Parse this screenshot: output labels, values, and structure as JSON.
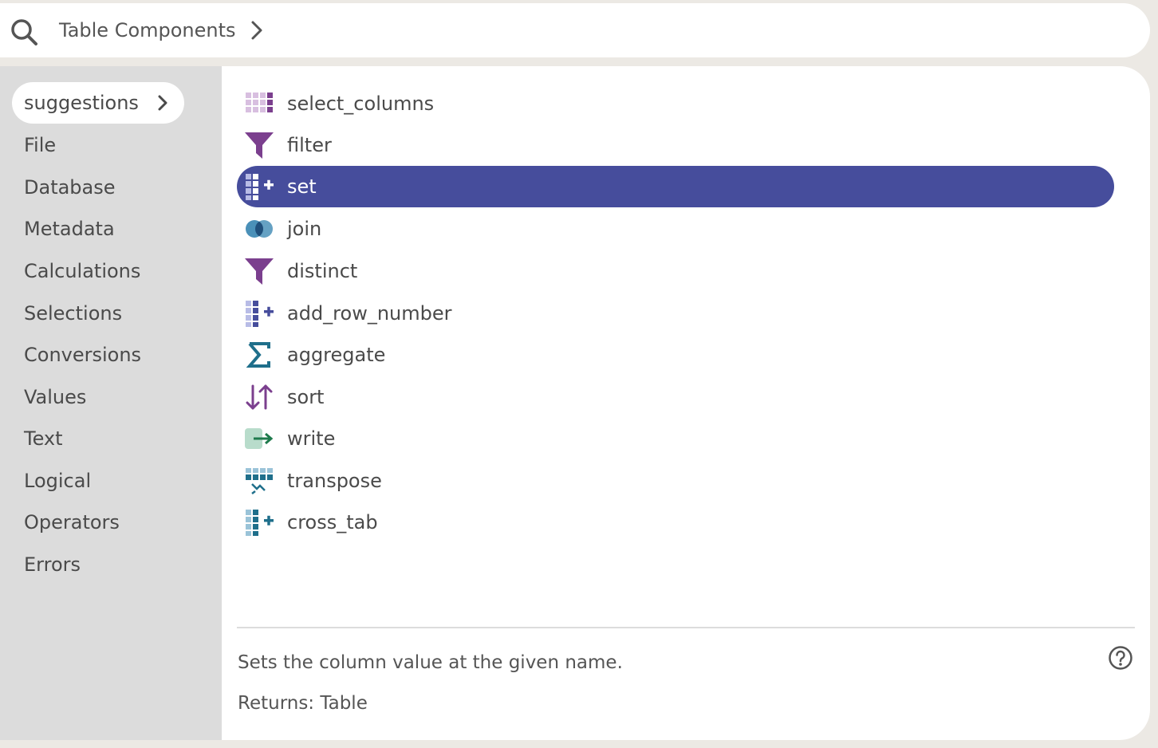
{
  "search": {
    "breadcrumb": "Table Components"
  },
  "sidebar": {
    "active": "suggestions",
    "items": [
      "File",
      "Database",
      "Metadata",
      "Calculations",
      "Selections",
      "Conversions",
      "Values",
      "Text",
      "Logical",
      "Operators",
      "Errors"
    ]
  },
  "list": {
    "items": [
      {
        "label": "select_columns",
        "icon": "select-columns-icon"
      },
      {
        "label": "filter",
        "icon": "filter-funnel-icon"
      },
      {
        "label": "set",
        "icon": "add-column-icon",
        "selected": true
      },
      {
        "label": "join",
        "icon": "join-circles-icon"
      },
      {
        "label": "distinct",
        "icon": "filter-funnel-icon"
      },
      {
        "label": "add_row_number",
        "icon": "add-column-icon"
      },
      {
        "label": "aggregate",
        "icon": "sigma-icon"
      },
      {
        "label": "sort",
        "icon": "sort-arrows-icon"
      },
      {
        "label": "write",
        "icon": "write-arrow-icon"
      },
      {
        "label": "transpose",
        "icon": "transpose-icon"
      },
      {
        "label": "cross_tab",
        "icon": "add-column-icon"
      }
    ]
  },
  "details": {
    "description": "Sets the column value at the given name.",
    "returns": "Returns: Table"
  },
  "colors": {
    "selected_bg": "#464d9c",
    "purple": "#7b3f8e",
    "teal": "#1f6f8b",
    "green": "#1e7a4c"
  }
}
